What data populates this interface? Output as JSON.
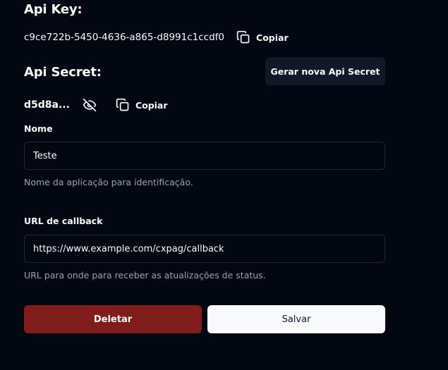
{
  "api_key": {
    "heading": "Api Key:",
    "value": "c9ce722b-5450-4636-a865-d8991c1ccdf0",
    "copy_label": "Copiar",
    "copy_icon": "copy-icon"
  },
  "api_secret": {
    "heading": "Api Secret:",
    "value": "d5d8a...",
    "toggle_icon": "eye-off-icon",
    "copy_label": "Copiar",
    "copy_icon": "copy-icon",
    "generate_label": "Gerar nova Api Secret"
  },
  "form": {
    "name": {
      "label": "Nome",
      "value": "Teste",
      "hint": "Nome da aplicação para identificação."
    },
    "callback": {
      "label": "URL de callback",
      "value": "https://www.example.com/cxpag/callback",
      "hint": "URL para onde para receber as atualizações de status."
    }
  },
  "actions": {
    "delete_label": "Deletar",
    "save_label": "Salvar"
  },
  "colors": {
    "background": "#030712",
    "delete": "#7f1d1d",
    "save": "#f8fafc",
    "secondary_button": "#111827"
  }
}
